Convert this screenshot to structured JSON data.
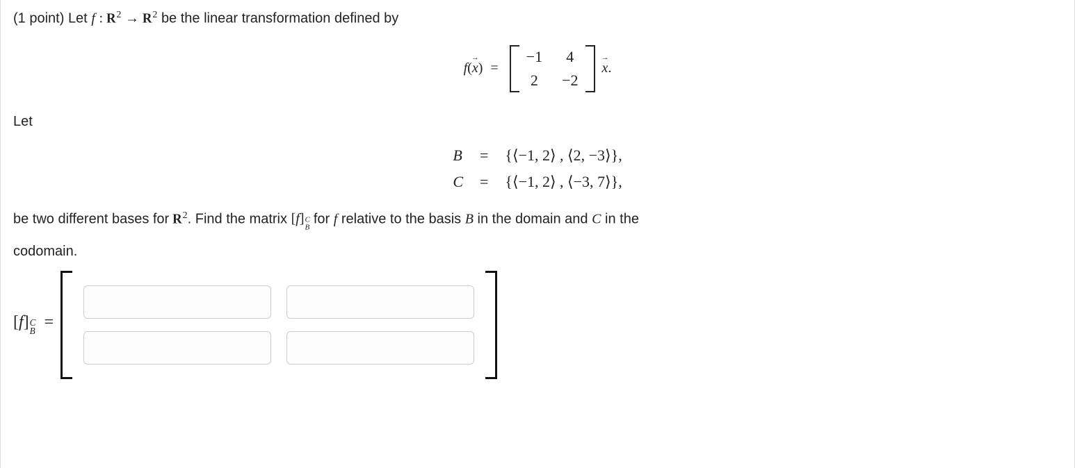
{
  "intro": {
    "points": "(1 point)",
    "let_text": "Let",
    "f": "f",
    "colon": ":",
    "R": "R",
    "exp2": "2",
    "arrow": "→",
    "linear_text": "be the linear transformation defined by"
  },
  "fx_eq": {
    "f": "f",
    "x": "x",
    "equals": "=",
    "m11": "−1",
    "m12": "4",
    "m21": "2",
    "m22": "−2",
    "dot": "."
  },
  "let2": "Let",
  "bases": {
    "B": "B",
    "C": "C",
    "eq": "=",
    "Bset": "{⟨−1, 2⟩ , ⟨2, −3⟩},",
    "Cset": "{⟨−1, 2⟩ , ⟨−3, 7⟩},"
  },
  "tail": {
    "t1": "be two different bases for",
    "R": "R",
    "exp2": "2",
    "t2": ". Find the matrix",
    "t3": "for",
    "f": "f",
    "t4": "relative to the basis",
    "B": "B",
    "t5": "in the domain and",
    "C": "C",
    "t6": "in the",
    "codomain": "codomain.",
    "fcb_open": "[",
    "fcb_close": "]",
    "scriptC": "C",
    "scriptB": "B"
  },
  "answer": {
    "label_open": "[",
    "label_f": "f",
    "label_close": "]",
    "superC": "C",
    "subB": "B",
    "equals": "="
  }
}
